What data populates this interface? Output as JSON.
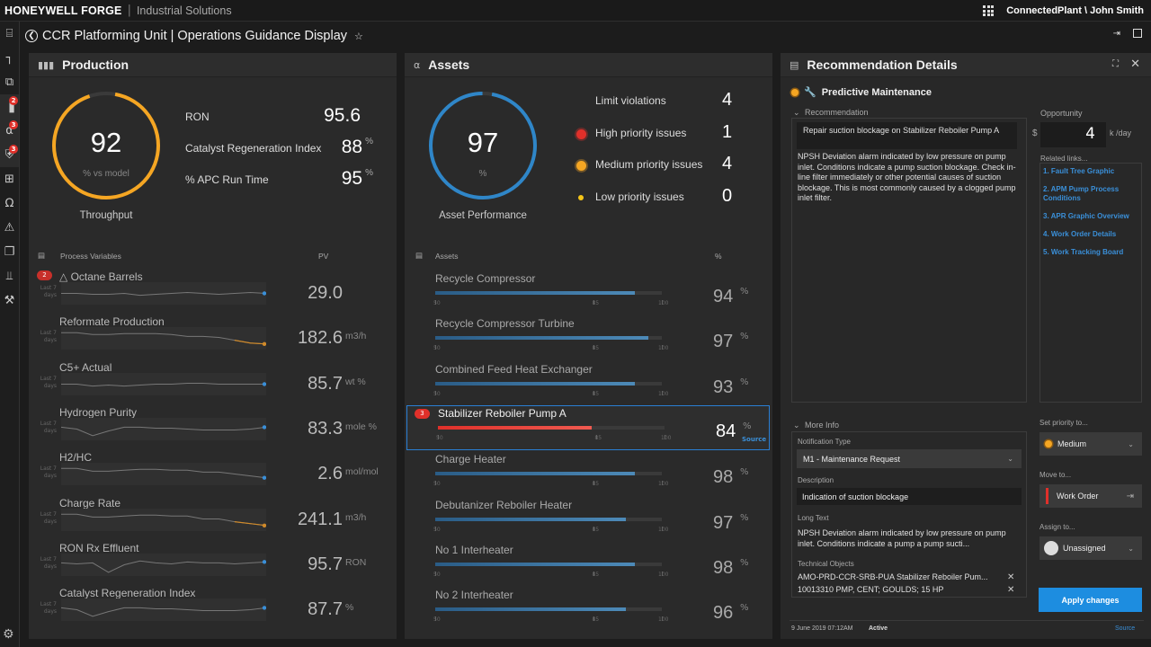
{
  "header": {
    "brand": "HONEYWELL FORGE",
    "separator": "|",
    "subtitle": "Industrial Solutions",
    "user": "ConnectedPlant \\ John Smith"
  },
  "sidebar": {
    "items": [
      {
        "icon": "bookmark-icon",
        "badge": null
      },
      {
        "icon": "hierarchy-icon",
        "badge": null
      },
      {
        "icon": "layers-icon",
        "badge": null
      },
      {
        "icon": "bar-chart-icon",
        "badge": "2"
      },
      {
        "icon": "asset-icon",
        "badge": "3"
      },
      {
        "icon": "shield-icon",
        "badge": "3"
      },
      {
        "icon": "add-box-icon",
        "badge": null
      },
      {
        "icon": "user-icon",
        "badge": null
      },
      {
        "icon": "warning-icon",
        "badge": null
      },
      {
        "icon": "folder-icon",
        "badge": null
      },
      {
        "icon": "route-icon",
        "badge": null
      },
      {
        "icon": "wrench-icon",
        "badge": null
      }
    ]
  },
  "page": {
    "title": "CCR Platforming Unit | Operations Guidance Display"
  },
  "production": {
    "title": "Production",
    "gauge": {
      "value": "92",
      "fraction": 0.92,
      "sublabel": "% vs model",
      "caption": "Throughput",
      "color": "#f5a623"
    },
    "kpis": [
      {
        "label": "RON",
        "value": "95.6",
        "unit": ""
      },
      {
        "label": "Catalyst Regeneration Index",
        "value": "88",
        "unit": "%"
      },
      {
        "label": "% APC Run Time",
        "value": "95",
        "unit": "%"
      }
    ],
    "list_header": "Process Variables",
    "pv_header": "PV",
    "last_label": "Last 7 days",
    "variables": [
      {
        "name": "△ Octane Barrels",
        "badge": "2",
        "value": "29.0",
        "unit": "",
        "trend": [
          0.5,
          0.5,
          0.55,
          0.55,
          0.5,
          0.6,
          0.55,
          0.5,
          0.45,
          0.5,
          0.55,
          0.5,
          0.45,
          0.5
        ],
        "end": "blue"
      },
      {
        "name": "Reformate Production",
        "badge": null,
        "value": "182.6",
        "unit": "m3/h",
        "trend": [
          0.2,
          0.2,
          0.3,
          0.3,
          0.25,
          0.25,
          0.25,
          0.3,
          0.4,
          0.4,
          0.45,
          0.6,
          0.75,
          0.8
        ],
        "end": "orange"
      },
      {
        "name": "C5+ Actual",
        "badge": null,
        "value": "85.7",
        "unit": "wt %",
        "trend": [
          0.5,
          0.5,
          0.6,
          0.55,
          0.6,
          0.55,
          0.5,
          0.5,
          0.45,
          0.45,
          0.5,
          0.5,
          0.5,
          0.5
        ],
        "end": "blue"
      },
      {
        "name": "Hydrogen Purity",
        "badge": null,
        "value": "83.3",
        "unit": "mole %",
        "trend": [
          0.4,
          0.5,
          0.85,
          0.6,
          0.4,
          0.4,
          0.45,
          0.45,
          0.5,
          0.55,
          0.55,
          0.55,
          0.5,
          0.4
        ],
        "end": "blue"
      },
      {
        "name": "H2/HC",
        "badge": null,
        "value": "2.6",
        "unit": "mol/mol",
        "trend": [
          0.2,
          0.2,
          0.35,
          0.35,
          0.3,
          0.25,
          0.25,
          0.3,
          0.3,
          0.4,
          0.4,
          0.5,
          0.6,
          0.7
        ],
        "end": "blue"
      },
      {
        "name": "Charge Rate",
        "badge": null,
        "value": "241.1",
        "unit": "m3/h",
        "trend": [
          0.2,
          0.2,
          0.35,
          0.35,
          0.3,
          0.25,
          0.25,
          0.3,
          0.3,
          0.45,
          0.45,
          0.6,
          0.7,
          0.8
        ],
        "end": "orange"
      },
      {
        "name": "RON Rx Effluent",
        "badge": null,
        "value": "95.7",
        "unit": "RON",
        "trend": [
          0.4,
          0.45,
          0.4,
          0.9,
          0.5,
          0.3,
          0.4,
          0.45,
          0.35,
          0.4,
          0.4,
          0.45,
          0.4,
          0.35
        ],
        "end": "blue"
      },
      {
        "name": "Catalyst Regeneration Index",
        "badge": null,
        "value": "87.7",
        "unit": "%",
        "trend": [
          0.4,
          0.5,
          0.85,
          0.6,
          0.4,
          0.4,
          0.45,
          0.45,
          0.5,
          0.55,
          0.55,
          0.55,
          0.5,
          0.4
        ],
        "end": "blue"
      }
    ]
  },
  "assets": {
    "title": "Assets",
    "gauge": {
      "value": "97",
      "fraction": 0.97,
      "sublabel": "%",
      "caption": "Asset Performance",
      "color": "#2f86c8"
    },
    "issues": [
      {
        "label": "Limit violations",
        "value": "4",
        "color": null
      },
      {
        "label": "High priority issues",
        "value": "1",
        "color": "#e0302a"
      },
      {
        "label": "Medium priority issues",
        "value": "4",
        "color": "#f5a623"
      },
      {
        "label": "Low priority issues",
        "value": "0",
        "color": "#f5c518"
      }
    ],
    "list_header": "Assets",
    "pct_header": "%",
    "scale_labels": [
      "50",
      "85",
      "100"
    ],
    "items": [
      {
        "name": "Recycle Compressor",
        "value": "94",
        "unit": "%",
        "fill": 0.94,
        "badge": null,
        "selected": false
      },
      {
        "name": "Recycle Compressor Turbine",
        "value": "97",
        "unit": "%",
        "fill": 0.97,
        "badge": null,
        "selected": false
      },
      {
        "name": "Combined Feed Heat Exchanger",
        "value": "93",
        "unit": "%",
        "fill": 0.94,
        "badge": null,
        "selected": false
      },
      {
        "name": "Stabilizer Reboiler Pump A",
        "value": "84",
        "unit": "%",
        "fill": 0.84,
        "badge": "3",
        "selected": true,
        "source": "Source"
      },
      {
        "name": "Charge Heater",
        "value": "98",
        "unit": "%",
        "fill": 0.94,
        "badge": null,
        "selected": false
      },
      {
        "name": "Debutanizer Reboiler Heater",
        "value": "97",
        "unit": "%",
        "fill": 0.92,
        "badge": null,
        "selected": false
      },
      {
        "name": "No 1 Interheater",
        "value": "98",
        "unit": "%",
        "fill": 0.94,
        "badge": null,
        "selected": false
      },
      {
        "name": "No 2 Interheater",
        "value": "96",
        "unit": "%",
        "fill": 0.92,
        "badge": null,
        "selected": false
      }
    ]
  },
  "recommendation": {
    "title": "Recommendation Details",
    "category": "Predictive Maintenance",
    "section_label": "Recommendation",
    "rec_title": "Repair suction blockage on Stabilizer Reboiler Pump A",
    "rec_body": "NPSH Deviation alarm indicated by low pressure on pump inlet. Conditions indicate a pump suction blockage. Check in-line filter immediately or other potential causes of suction blockage. This is most commonly caused by a clogged pump inlet filter.",
    "opportunity_label": "Opportunity",
    "currency": "$",
    "opportunity_value": "4",
    "opportunity_unit": "k /day",
    "related_label": "Related links...",
    "links": [
      "1. Fault Tree Graphic",
      "2. APM Pump Process Conditions",
      "3. APR Graphic Overview",
      "4. Work Order Details",
      "5. Work Tracking Board"
    ],
    "more_info_label": "More Info",
    "notification_type_label": "Notification Type",
    "notification_type": "M1 - Maintenance Request",
    "description_label": "Description",
    "description": "Indication of suction blockage",
    "long_text_label": "Long Text",
    "long_text": "NPSH Deviation alarm indicated by low pressure on pump inlet. Conditions indicate a pump a pump sucti...",
    "technical_objects_label": "Technical Objects",
    "technical_objects": [
      "AMO-PRD-CCR-SRB-PUA Stabilizer Reboiler Pum...",
      "10013310 PMP, CENT; GOULDS; 15 HP"
    ],
    "priority_label": "Set priority to...",
    "priority": "Medium",
    "move_label": "Move to...",
    "move_to": "Work Order",
    "assign_label": "Assign to...",
    "assignee": "Unassigned",
    "apply_label": "Apply changes",
    "timestamp": "9 June 2019 07:12AM",
    "status": "Active",
    "source_link": "Source"
  }
}
